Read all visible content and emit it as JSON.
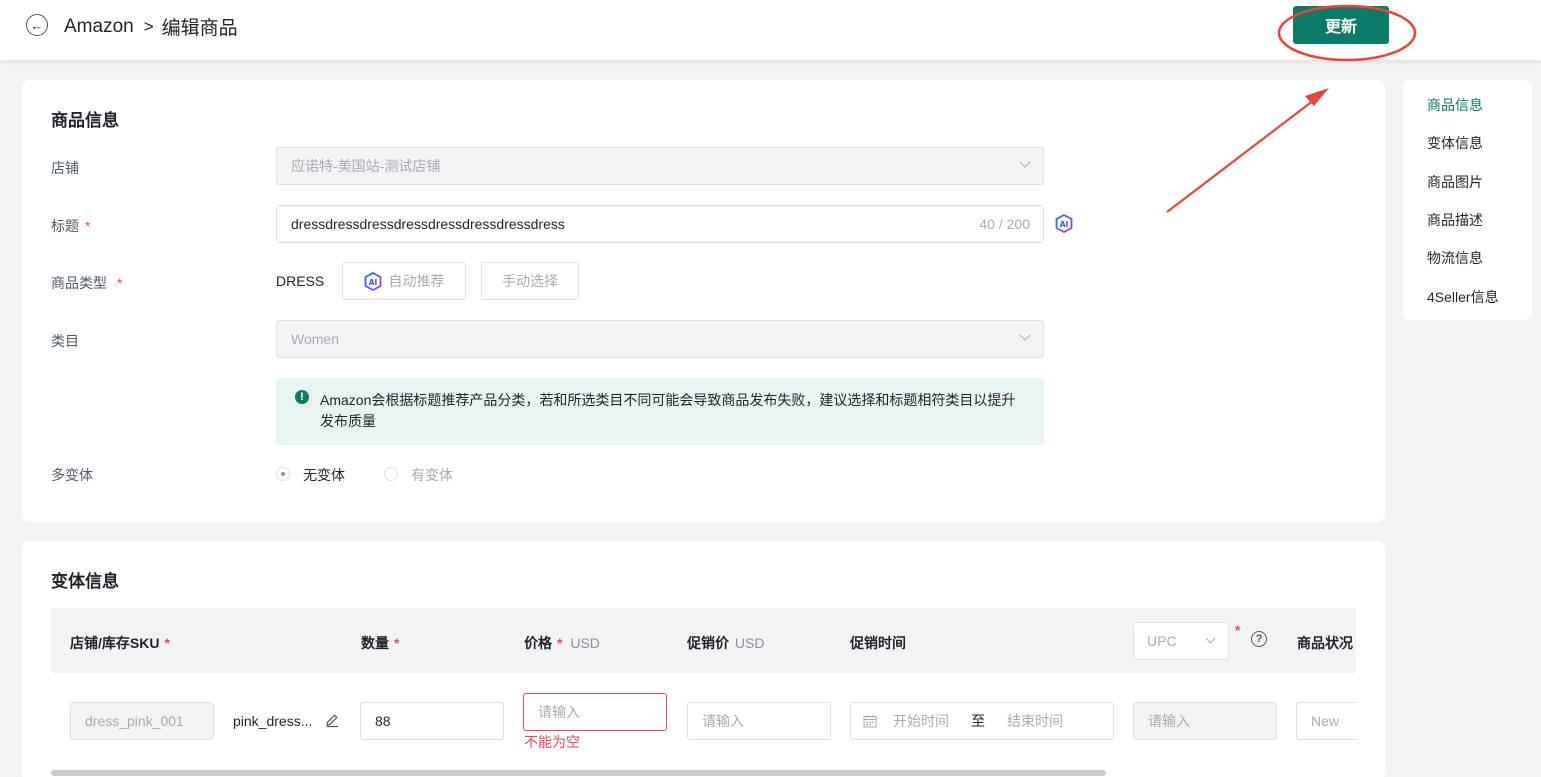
{
  "header": {
    "back_icon": "←",
    "app": "Amazon",
    "separator": ">",
    "page": "编辑商品",
    "update_label": "更新"
  },
  "product_info": {
    "section_title": "商品信息",
    "store": {
      "label": "店铺",
      "value": "应诺特-美国站-测试店铺"
    },
    "title": {
      "label": "标题",
      "required": "*",
      "value": "dressdressdressdressdressdressdressdress",
      "counter": "40 / 200"
    },
    "product_type": {
      "label": "商品类型",
      "required": "*",
      "value": "DRESS",
      "auto_label": "自动推荐",
      "manual_label": "手动选择"
    },
    "category": {
      "label": "类目",
      "placeholder": "Women"
    },
    "info_icon": "!",
    "info_text": "Amazon会根据标题推荐产品分类，若和所选类目不同可能会导致商品发布失败，建议选择和标题相符类目以提升发布质量",
    "variant": {
      "label": "多变体",
      "option_none": "无变体",
      "option_has": "有变体"
    }
  },
  "nav": {
    "items": [
      "商品信息",
      "变体信息",
      "商品图片",
      "商品描述",
      "物流信息",
      "4Seller信息"
    ]
  },
  "variant_info": {
    "section_title": "变体信息",
    "headers": {
      "sku": "店铺/库存SKU",
      "qty": "数量",
      "price": "价格",
      "price_unit": "USD",
      "promo_price": "促销价",
      "promo_unit": "USD",
      "promo_time": "促销时间",
      "upc": "UPC",
      "help": "?",
      "condition": "商品状况"
    },
    "required_mark": "*",
    "row": {
      "sku": "dress_pink_001",
      "name": "pink_dress...",
      "qty": "88",
      "price_placeholder": "请输入",
      "price_error": "不能为空",
      "promo_placeholder": "请输入",
      "start_placeholder": "开始时间",
      "to": "至",
      "end_placeholder": "结束时间",
      "upc_placeholder": "请输入",
      "condition": "New"
    }
  },
  "colors": {
    "primary": "#0b7a66",
    "error": "#e34d59",
    "annotation": "#e8453c"
  }
}
